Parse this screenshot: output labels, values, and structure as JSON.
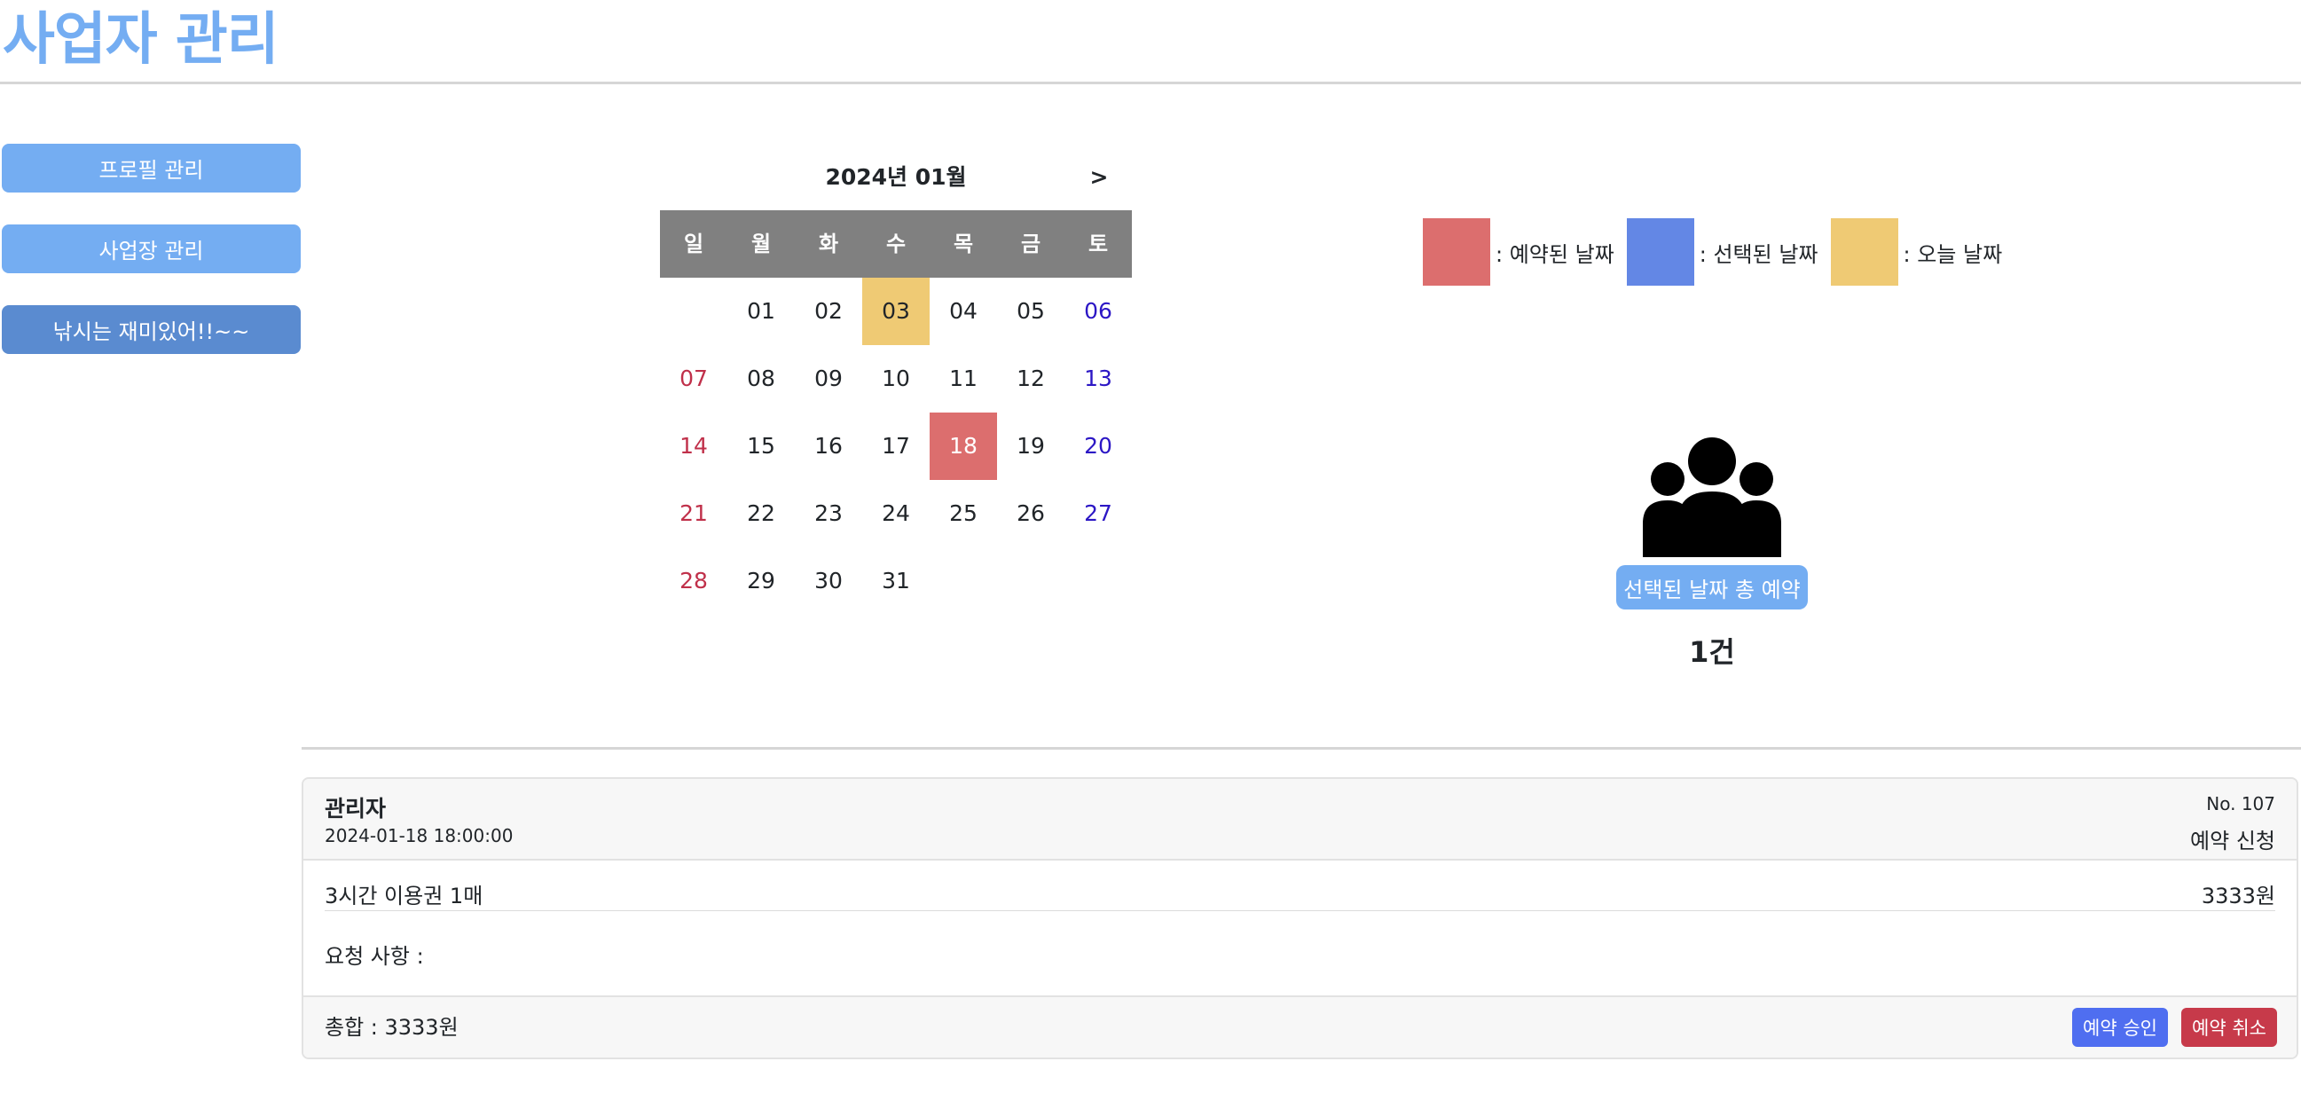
{
  "header": {
    "title": "사업자 관리",
    "title_color": "#74adf2"
  },
  "sidebar": {
    "items": [
      {
        "label": "프로필 관리",
        "color": "#74adf2"
      },
      {
        "label": "사업장 관리",
        "color": "#74adf2"
      },
      {
        "label": "낚시는 재미있어!!~~",
        "color": "#5a8bd0",
        "active": true
      }
    ]
  },
  "calendar": {
    "month_label": "2024년 01월",
    "next_label": ">",
    "header_bg": "#808080",
    "weekdays": [
      "일",
      "월",
      "화",
      "수",
      "목",
      "금",
      "토"
    ],
    "sunday_color": "#c0304a",
    "saturday_color": "#2c17c5",
    "days": [
      "",
      "01",
      "02",
      "03",
      "04",
      "05",
      "06",
      "07",
      "08",
      "09",
      "10",
      "11",
      "12",
      "13",
      "14",
      "15",
      "16",
      "17",
      "18",
      "19",
      "20",
      "21",
      "22",
      "23",
      "24",
      "25",
      "26",
      "27",
      "28",
      "29",
      "30",
      "31"
    ],
    "today": "03",
    "reserved": [
      "18"
    ]
  },
  "legend": [
    {
      "label": ": 예약된 날짜",
      "color": "#dc6e6e"
    },
    {
      "label": ": 선택된 날짜",
      "color": "#6387e5"
    },
    {
      "label": ": 오늘 날짜",
      "color": "#efca74"
    }
  ],
  "summary": {
    "icon": "users-icon",
    "badge_label": "선택된 날짜 총 예약",
    "badge_color": "#74adf2",
    "count": "1건"
  },
  "reservation": {
    "name": "관리자",
    "datetime": "2024-01-18 18:00:00",
    "number": "No. 107",
    "status": "예약 신청",
    "item_name": "3시간 이용권 1매",
    "item_price": "3333원",
    "request_label": "요청 사항 :",
    "total": "총합 : 3333원",
    "approve_label": "예약 승인",
    "approve_color": "#4f6ef0",
    "cancel_label": "예약 취소",
    "cancel_color": "#c73a4a"
  }
}
